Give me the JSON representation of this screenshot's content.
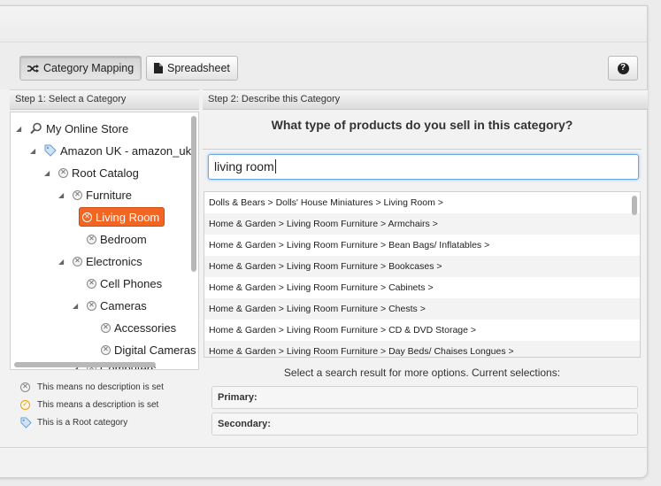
{
  "toolbar": {
    "category_mapping_label": "Category Mapping",
    "spreadsheet_label": "Spreadsheet",
    "help_label": "?"
  },
  "left": {
    "header": "Step 1: Select a Category",
    "tree": [
      {
        "label": "My Online Store",
        "icon": "search-icon"
      },
      {
        "label": "Amazon UK - amazon_uk",
        "icon": "tag-icon"
      },
      {
        "label": "Root Catalog",
        "icon": "no-description-icon"
      },
      {
        "label": "Furniture",
        "icon": "no-description-icon"
      },
      {
        "label": "Living Room",
        "icon": "no-description-icon",
        "selected": true
      },
      {
        "label": "Bedroom",
        "icon": "no-description-icon"
      },
      {
        "label": "Electronics",
        "icon": "no-description-icon"
      },
      {
        "label": "Cell Phones",
        "icon": "no-description-icon"
      },
      {
        "label": "Cameras",
        "icon": "no-description-icon"
      },
      {
        "label": "Accessories",
        "icon": "no-description-icon"
      },
      {
        "label": "Digital Cameras",
        "icon": "no-description-icon"
      },
      {
        "label": "Computers",
        "icon": "no-description-icon"
      }
    ],
    "legend": {
      "no_description": "This means no description is set",
      "description_set": "This means a description is set",
      "root_category": "This is a Root category"
    }
  },
  "right": {
    "header": "Step 2: Describe this Category",
    "question": "What type of products do you sell in this category?",
    "search_value": "living room",
    "results": [
      "Dolls & Bears > Dolls' House Miniatures > Living Room >",
      "Home & Garden > Living Room Furniture > Armchairs >",
      "Home & Garden > Living Room Furniture > Bean Bags/ Inflatables >",
      "Home & Garden > Living Room Furniture > Bookcases >",
      "Home & Garden > Living Room Furniture > Cabinets >",
      "Home & Garden > Living Room Furniture > Chests >",
      "Home & Garden > Living Room Furniture > CD & DVD Storage >",
      "Home & Garden > Living Room Furniture > Day Beds/ Chaises Longues >"
    ],
    "instructions": "Select a search result for more options. Current selections:",
    "primary_label": "Primary:",
    "secondary_label": "Secondary:"
  },
  "colors": {
    "accent": "#f26522",
    "focus": "#6aa8e0"
  }
}
